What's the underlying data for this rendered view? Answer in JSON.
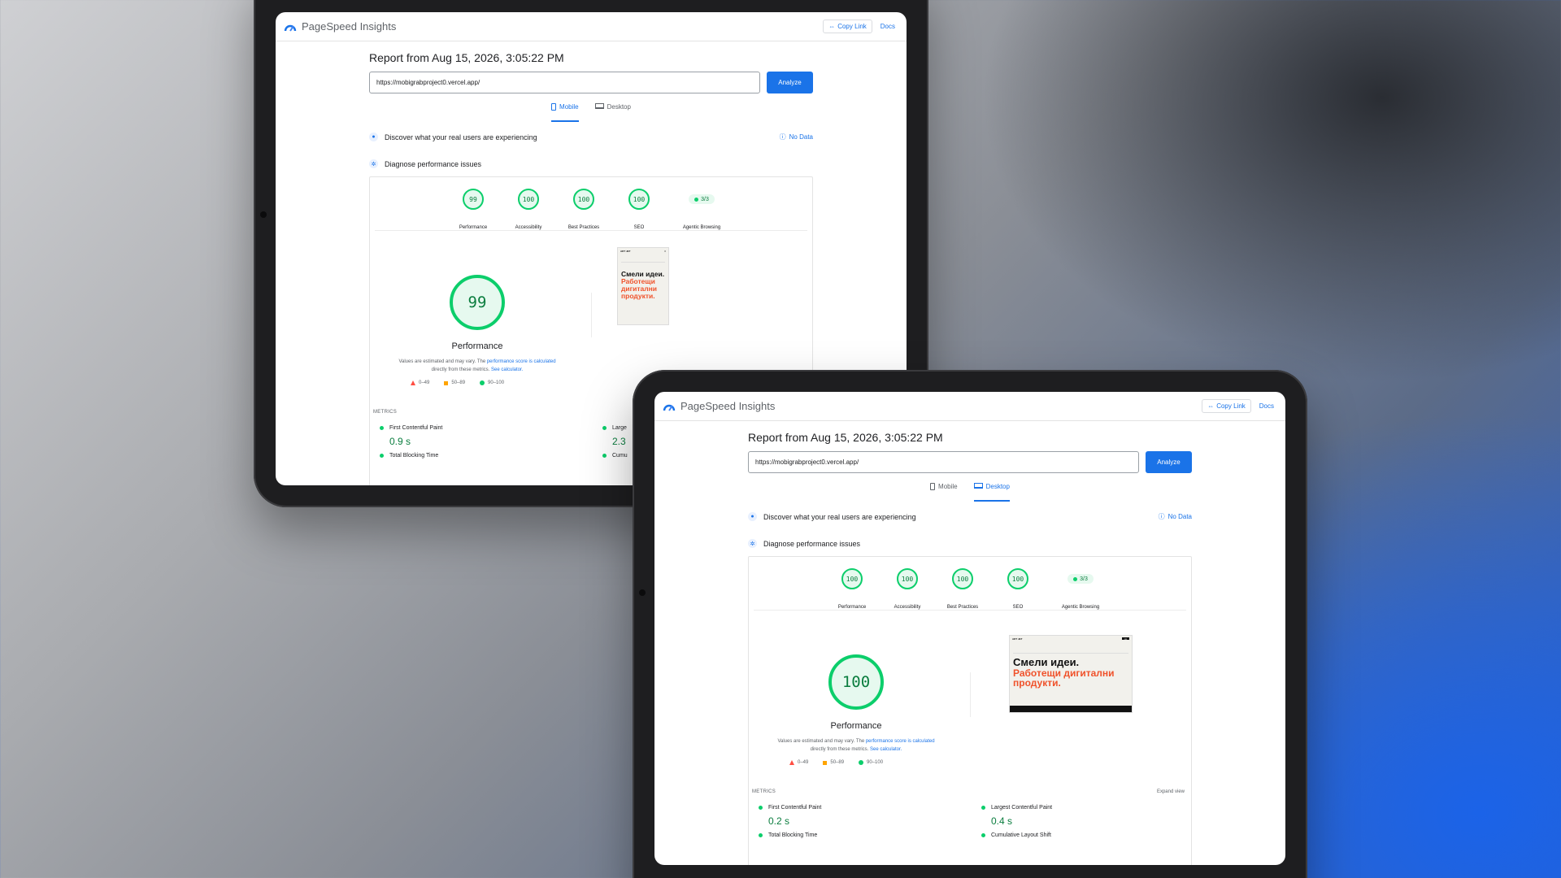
{
  "app": {
    "title": "PageSpeed Insights",
    "copy_link": "Copy Link",
    "docs": "Docs"
  },
  "report": {
    "title": "Report from Aug 15, 2026, 3:05:22 PM",
    "url": "https://mobigrabproject0.vercel.app/",
    "analyze": "Analyze"
  },
  "tabs": {
    "mobile": "Mobile",
    "desktop": "Desktop"
  },
  "sections": {
    "field": "Discover what your real users are experiencing",
    "no_data": "No Data",
    "lab": "Diagnose performance issues"
  },
  "categories": {
    "performance": "Performance",
    "accessibility": "Accessibility",
    "best_practices": "Best Practices",
    "seo": "SEO",
    "agentic": "Agentic Browsing"
  },
  "mobile": {
    "performance": "99",
    "accessibility": "100",
    "best_practices": "100",
    "seo": "100",
    "agentic": "3/3",
    "big_score": "99",
    "fcp": "0.9 s",
    "lcp": "2.3"
  },
  "desktop": {
    "performance": "100",
    "accessibility": "100",
    "best_practices": "100",
    "seo": "100",
    "agentic": "3/3",
    "big_score": "100",
    "fcp": "0.2 s",
    "lcp": "0.4 s"
  },
  "perf": {
    "label": "Performance",
    "note1": "Values are estimated and may vary. The ",
    "note_link": "performance score is calculated",
    "note2": " directly from these metrics. ",
    "calc_link": "See calculator."
  },
  "legend": {
    "low": "0–49",
    "mid": "50–89",
    "high": "90–100"
  },
  "metrics": {
    "header": "METRICS",
    "expand": "Expand view",
    "fcp": "First Contentful Paint",
    "lcp": "Largest Contentful Paint",
    "tbt": "Total Blocking Time",
    "cls": "Cumulative Layout Shift",
    "lcp_short": "Large",
    "cls_short": "Cumu"
  },
  "thumb": {
    "brand": "ART JET",
    "line1": "Смели идеи.",
    "line2": "Работещи дигитални продукти."
  },
  "colors": {
    "accent": "#1a73e8",
    "pass": "#0cce6b",
    "average": "#ffa400",
    "fail": "#ff4e42"
  }
}
